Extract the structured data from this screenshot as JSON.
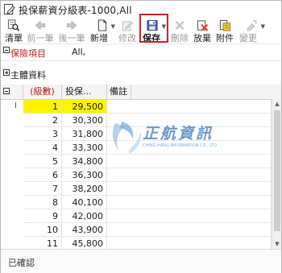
{
  "window": {
    "title": "投保薪資分級表-1000,All"
  },
  "toolbar": [
    {
      "key": "clear",
      "label": "清單",
      "icon": "search-list-icon",
      "enabled": true
    },
    {
      "key": "prev",
      "label": "前一筆",
      "icon": "arrow-left-icon",
      "enabled": false
    },
    {
      "key": "next",
      "label": "後一筆",
      "icon": "arrow-right-icon",
      "enabled": false
    },
    {
      "key": "add",
      "label": "新增",
      "icon": "new-document-icon",
      "enabled": true,
      "dropdown": true
    },
    {
      "key": "edit",
      "label": "修改",
      "icon": "edit-icon",
      "enabled": false
    },
    {
      "key": "save",
      "label": "保存",
      "icon": "save-disk-icon",
      "enabled": true,
      "dropdown": true,
      "highlighted": true
    },
    {
      "key": "delete",
      "label": "刪除",
      "icon": "delete-x-icon",
      "enabled": false
    },
    {
      "key": "abandon",
      "label": "放棄",
      "icon": "abandon-icon",
      "enabled": true
    },
    {
      "key": "attach",
      "label": "附件",
      "icon": "attachment-icon",
      "enabled": true
    },
    {
      "key": "change",
      "label": "變更",
      "icon": "change-icon",
      "enabled": false,
      "dropdown": true
    }
  ],
  "filter": {
    "label": "保險項目",
    "value": "All,"
  },
  "sections": {
    "main_info": "主體資料"
  },
  "grid": {
    "columns": [
      "(級數)",
      "投保...",
      "備註"
    ],
    "rows": [
      {
        "level": "1",
        "amount": "29,500",
        "note": ""
      },
      {
        "level": "2",
        "amount": "30,300",
        "note": ""
      },
      {
        "level": "3",
        "amount": "31,800",
        "note": ""
      },
      {
        "level": "4",
        "amount": "33,300",
        "note": ""
      },
      {
        "level": "5",
        "amount": "34,800",
        "note": ""
      },
      {
        "level": "6",
        "amount": "36,300",
        "note": ""
      },
      {
        "level": "7",
        "amount": "38,200",
        "note": ""
      },
      {
        "level": "8",
        "amount": "40,100",
        "note": ""
      },
      {
        "level": "9",
        "amount": "42,000",
        "note": ""
      },
      {
        "level": "10",
        "amount": "43,900",
        "note": ""
      },
      {
        "level": "11",
        "amount": "45,800",
        "note": ""
      }
    ],
    "selected_row": 0
  },
  "watermark": {
    "name": "正航資訊",
    "subtitle": "CHING HANG INFORMATION CO., LTD"
  },
  "status": {
    "text": "已確認"
  },
  "colors": {
    "highlight": "#fff200",
    "accent_red": "#c01818",
    "save_box": "#d02020"
  }
}
